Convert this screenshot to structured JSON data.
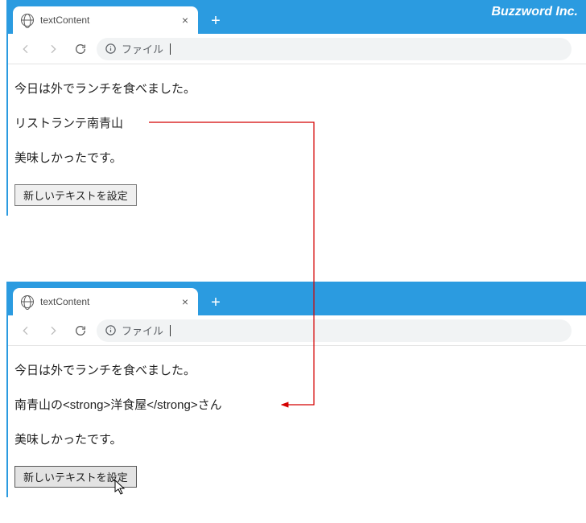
{
  "brand": "Buzzword Inc.",
  "top": {
    "tab_title": "textContent",
    "url_label": "ファイル",
    "p1": "今日は外でランチを食べました。",
    "p2": "リストランテ南青山",
    "p3": "美味しかったです。",
    "button_label": "新しいテキストを設定"
  },
  "bottom": {
    "tab_title": "textContent",
    "url_label": "ファイル",
    "p1": "今日は外でランチを食べました。",
    "p2": "南青山の<strong>洋食屋</strong>さん",
    "p3": "美味しかったです。",
    "button_label": "新しいテキストを設定"
  }
}
